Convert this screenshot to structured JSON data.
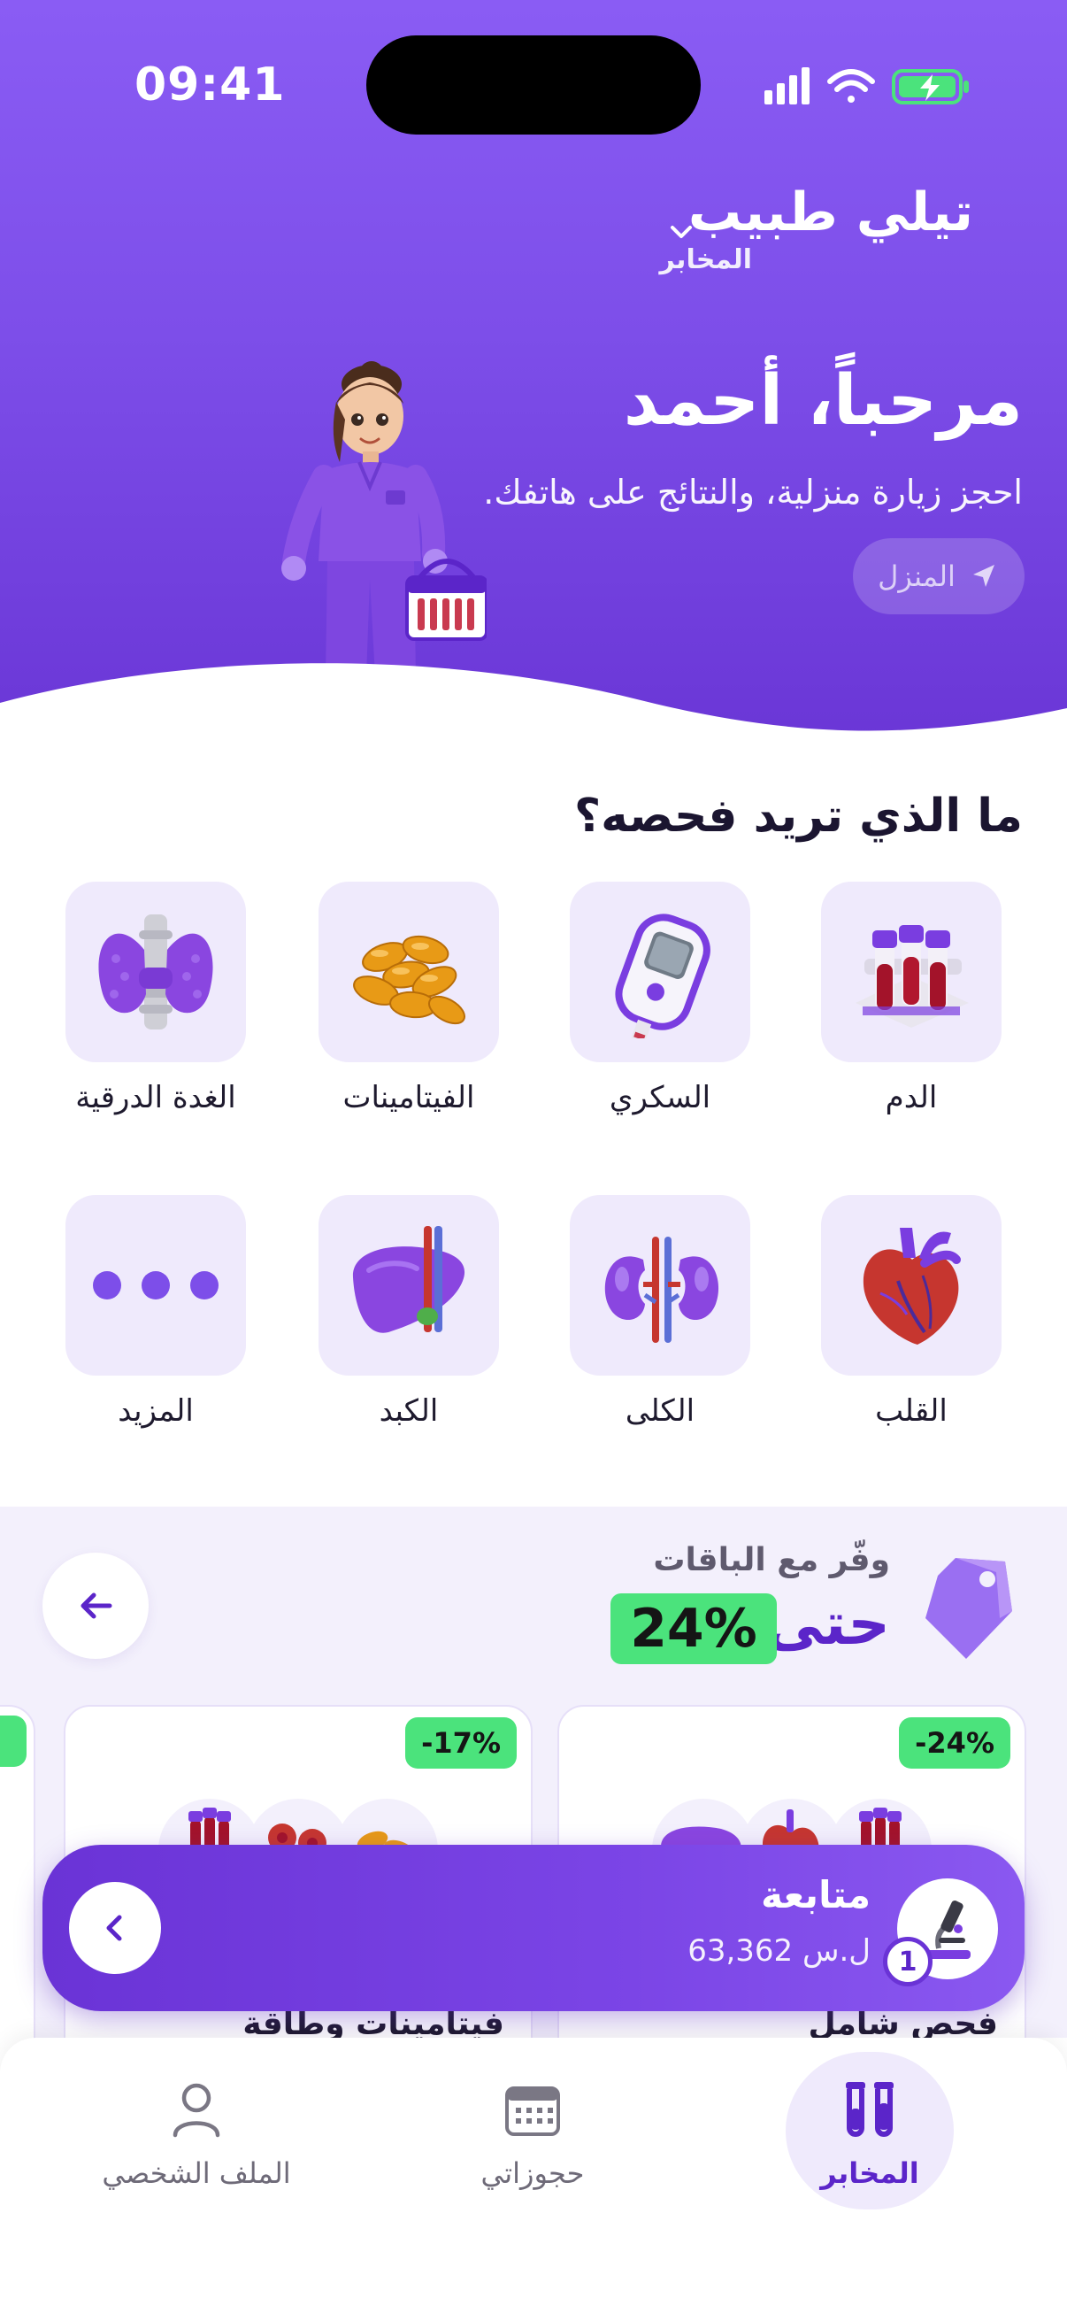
{
  "status_bar": {
    "time": "09:41"
  },
  "header": {
    "brand_name": "تيلي طبيب",
    "brand_sub": "المخابر",
    "greeting": "مرحباً، أحمد",
    "subtitle": "احجز زيارة منزلية، والنتائج على هاتفك.",
    "location_label": "المنزل"
  },
  "categories": {
    "title": "ما الذي تريد فحصه؟",
    "items": [
      {
        "label": "الدم",
        "icon": "blood-tubes-icon"
      },
      {
        "label": "السكري",
        "icon": "glucometer-icon"
      },
      {
        "label": "الفيتامينات",
        "icon": "vitamin-capsules-icon"
      },
      {
        "label": "الغدة الدرقية",
        "icon": "thyroid-icon"
      },
      {
        "label": "القلب",
        "icon": "heart-icon"
      },
      {
        "label": "الكلى",
        "icon": "kidneys-icon"
      },
      {
        "label": "الكبد",
        "icon": "liver-icon"
      },
      {
        "label": "المزيد",
        "icon": "more-dots-icon"
      }
    ]
  },
  "promo": {
    "subtitle": "وفّر مع الباقات",
    "up_to": "حتى",
    "percent": "24%"
  },
  "packages": [
    {
      "badge": "-24%",
      "title": "فحص شامل"
    },
    {
      "badge": "-17%",
      "title": "فيتامينات وطاقة"
    }
  ],
  "cart": {
    "title": "متابعة",
    "price": "ل.س 63,362",
    "count": "1"
  },
  "tabs": [
    {
      "label": "المخابر",
      "icon": "test-tubes-icon",
      "active": true
    },
    {
      "label": "حجوزاتي",
      "icon": "calendar-icon",
      "active": false
    },
    {
      "label": "الملف الشخصي",
      "icon": "profile-icon",
      "active": false
    }
  ],
  "colors": {
    "primary": "#7d4ee9",
    "primary_dark": "#5b25c9",
    "accent_green": "#4be37c",
    "tile_bg": "#efeafc"
  }
}
